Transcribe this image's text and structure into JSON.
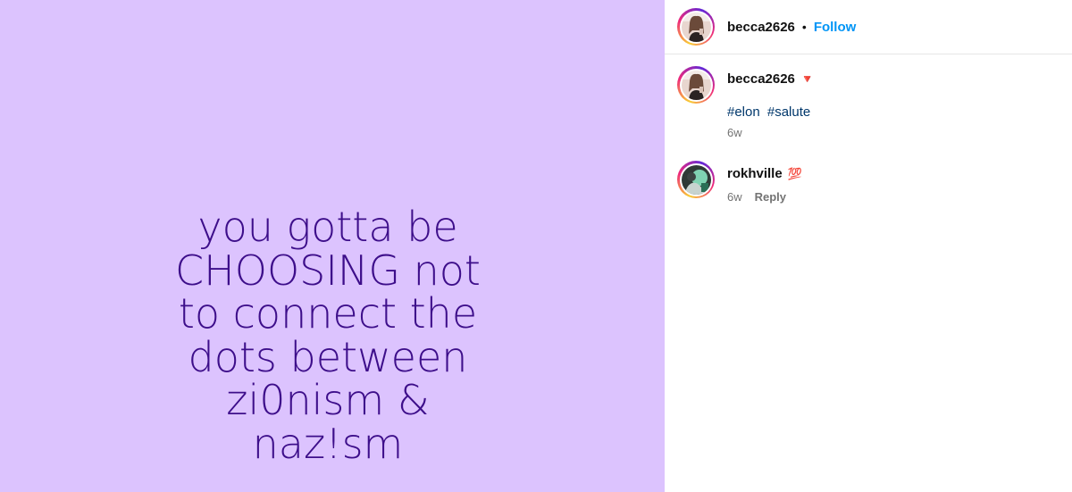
{
  "post": {
    "quote_lines": [
      "you gotta be",
      "CHOOSING not",
      "to connect the",
      "dots between",
      "zi0nism &",
      "naz!sm"
    ],
    "background_color": "#dcc3fe",
    "text_color": "#3d0e8a"
  },
  "header": {
    "username": "becca2626",
    "separator": "•",
    "follow_label": "Follow"
  },
  "caption": {
    "username": "becca2626",
    "badge": "🔻",
    "hashtags": [
      "#elon",
      "#salute"
    ],
    "time": "6w"
  },
  "comments": [
    {
      "username": "rokhville",
      "badge": "💯",
      "time": "6w",
      "reply_label": "Reply"
    }
  ],
  "colors": {
    "accent": "#0095f6",
    "hashtag": "#00376b",
    "meta": "#737373"
  }
}
